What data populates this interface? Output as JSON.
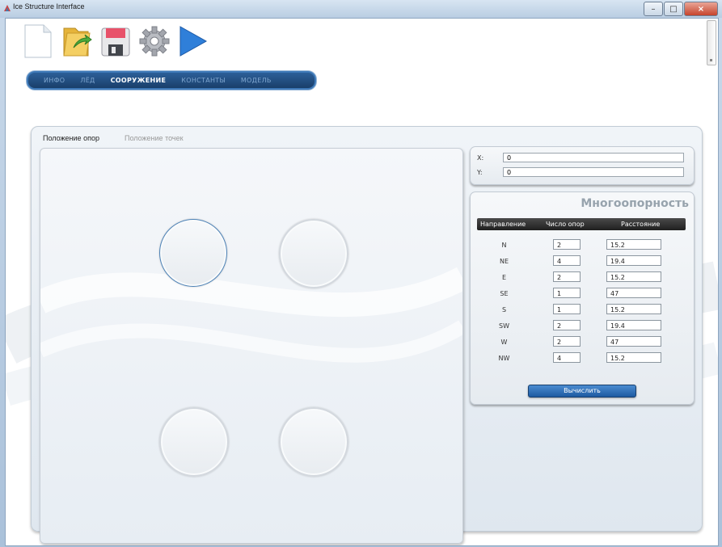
{
  "window": {
    "title": "Ice Structure Interface",
    "controls": [
      "minimize",
      "maximize",
      "close"
    ]
  },
  "toolbar": {
    "icons": [
      "new-file-icon",
      "open-folder-icon",
      "save-disk-icon",
      "settings-gear-icon",
      "run-play-icon"
    ]
  },
  "nav": {
    "items": [
      {
        "label": "ИНФО",
        "active": false
      },
      {
        "label": "ЛЁД",
        "active": false
      },
      {
        "label": "СООРУЖЕНИЕ",
        "active": true
      },
      {
        "label": "КОНСТАНТЫ",
        "active": false
      },
      {
        "label": "МОДЕЛЬ",
        "active": false
      }
    ]
  },
  "subtabs": [
    {
      "label": "Положение опор",
      "active": true
    },
    {
      "label": "Положение точек",
      "active": false
    }
  ],
  "coords": {
    "x_label": "X:",
    "x_value": "0",
    "y_label": "Y:",
    "y_value": "0"
  },
  "multi": {
    "title": "Многоопорность",
    "headers": [
      "Направление",
      "Число опор",
      "Расстояние"
    ],
    "rows": [
      {
        "dir": "N",
        "count": "2",
        "dist": "15.2"
      },
      {
        "dir": "NE",
        "count": "4",
        "dist": "19.4"
      },
      {
        "dir": "E",
        "count": "2",
        "dist": "15.2"
      },
      {
        "dir": "SE",
        "count": "1",
        "dist": "47"
      },
      {
        "dir": "S",
        "count": "1",
        "dist": "15.2"
      },
      {
        "dir": "SW",
        "count": "2",
        "dist": "19.4"
      },
      {
        "dir": "W",
        "count": "2",
        "dist": "47"
      },
      {
        "dir": "NW",
        "count": "4",
        "dist": "15.2"
      }
    ],
    "calc_label": "Вычислить"
  },
  "colors": {
    "nav_bg": "#1a3f6a",
    "accent": "#2f6fb8",
    "selected_pier": "#4d82b6"
  }
}
